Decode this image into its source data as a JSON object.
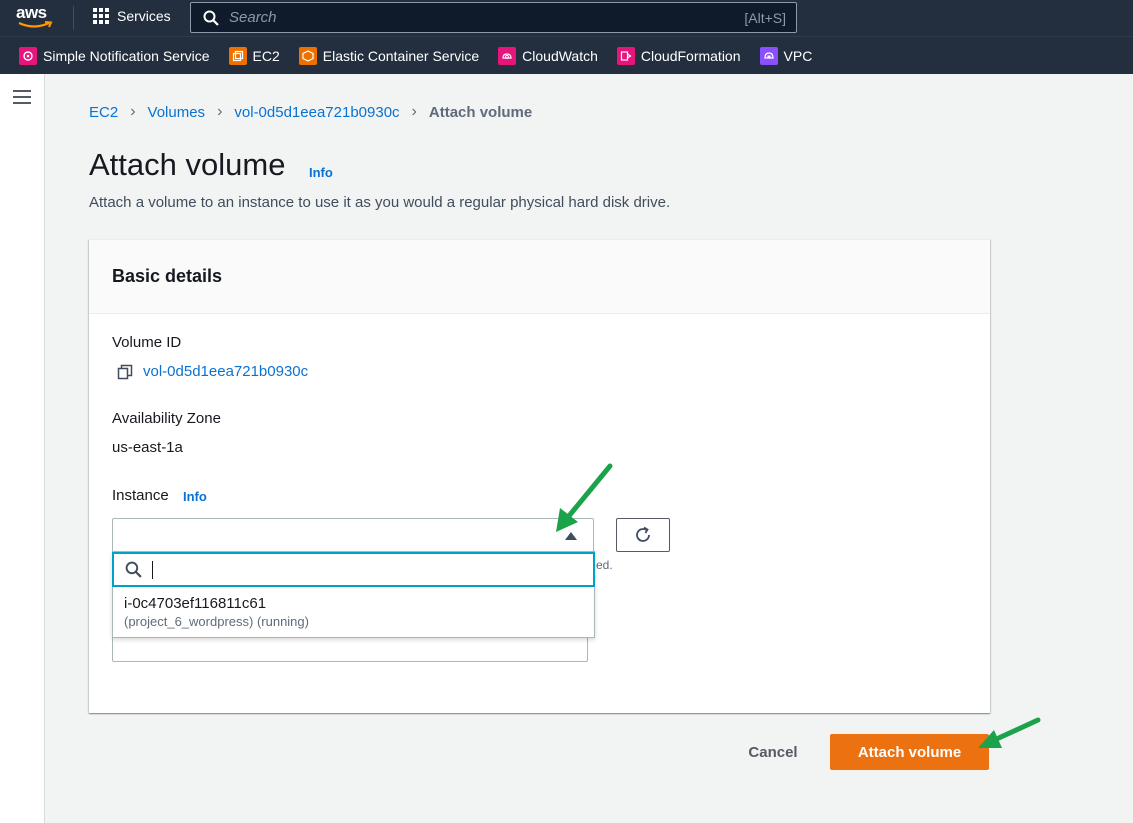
{
  "topnav": {
    "logo_text": "aws",
    "services_label": "Services",
    "search_placeholder": "Search",
    "search_shortcut": "[Alt+S]"
  },
  "favorites": [
    {
      "label": "Simple Notification Service",
      "color": "#e7157b",
      "icon": "sns-icon"
    },
    {
      "label": "EC2",
      "color": "#ed7100",
      "icon": "ec2-icon"
    },
    {
      "label": "Elastic Container Service",
      "color": "#ed7100",
      "icon": "ecs-icon"
    },
    {
      "label": "CloudWatch",
      "color": "#e7157b",
      "icon": "cloudwatch-icon"
    },
    {
      "label": "CloudFormation",
      "color": "#e7157b",
      "icon": "cloudformation-icon"
    },
    {
      "label": "VPC",
      "color": "#8c4fff",
      "icon": "vpc-icon"
    }
  ],
  "breadcrumb": {
    "items": [
      "EC2",
      "Volumes",
      "vol-0d5d1eea721b0930c"
    ],
    "current": "Attach volume"
  },
  "page": {
    "title": "Attach volume",
    "title_info": "Info",
    "description": "Attach a volume to an instance to use it as you would a regular physical hard disk drive."
  },
  "card": {
    "header": "Basic details",
    "volume_id_label": "Volume ID",
    "volume_id_value": "vol-0d5d1eea721b0930c",
    "az_label": "Availability Zone",
    "az_value": "us-east-1a",
    "instance_label": "Instance",
    "instance_info": "Info",
    "hint_fragment": "ed.",
    "dropdown": {
      "search_value": "",
      "options": [
        {
          "id": "i-0c4703ef116811c61",
          "detail": "(project_6_wordpress) (running)"
        }
      ]
    }
  },
  "footer": {
    "cancel_label": "Cancel",
    "submit_label": "Attach volume"
  },
  "colors": {
    "nav_bg": "#232f3e",
    "link": "#0972d3",
    "primary": "#ec7211",
    "focus": "#00a1c9",
    "annotation_arrow": "#1aa34a"
  }
}
